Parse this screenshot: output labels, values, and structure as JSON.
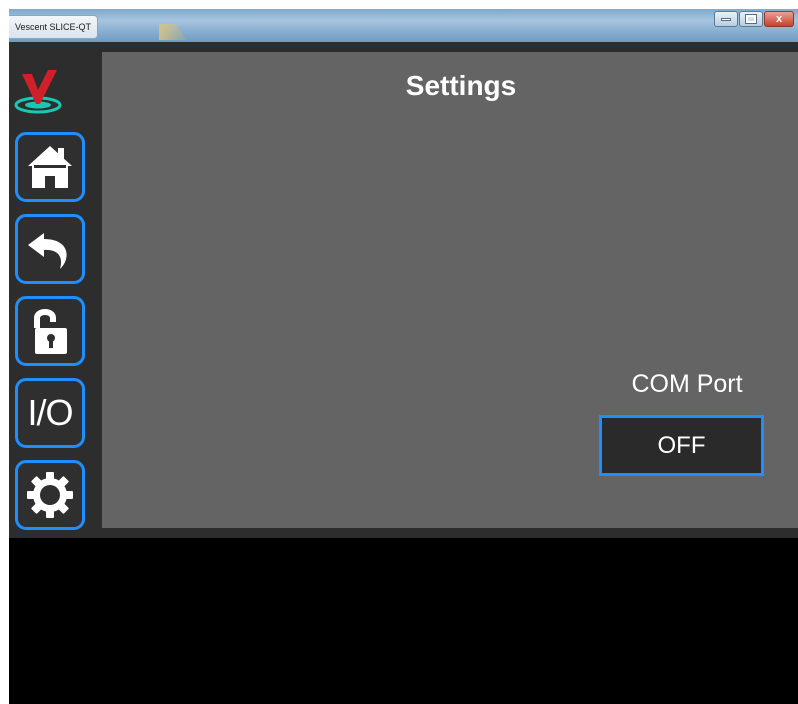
{
  "window": {
    "title": "Vescent SLICE-QT",
    "controls": {
      "minimize_icon": "minimize-icon",
      "maximize_icon": "maximize-icon",
      "close_glyph": "x"
    }
  },
  "sidebar": {
    "logo_icon": "vescent-logo-icon",
    "items": [
      {
        "name": "home",
        "icon": "home-icon"
      },
      {
        "name": "back",
        "icon": "back-arrow-icon"
      },
      {
        "name": "lock",
        "icon": "unlocked-padlock-icon"
      },
      {
        "name": "io",
        "label": "I/O"
      },
      {
        "name": "settings",
        "icon": "gear-icon"
      }
    ]
  },
  "main": {
    "title": "Settings",
    "com_port": {
      "label": "COM Port",
      "value": "OFF"
    }
  },
  "colors": {
    "accent_border": "#1f8fff",
    "panel_bg": "#646464",
    "sidebar_bg": "#2d2d2d",
    "logo_red": "#d0202a",
    "logo_teal": "#19c7b5"
  }
}
